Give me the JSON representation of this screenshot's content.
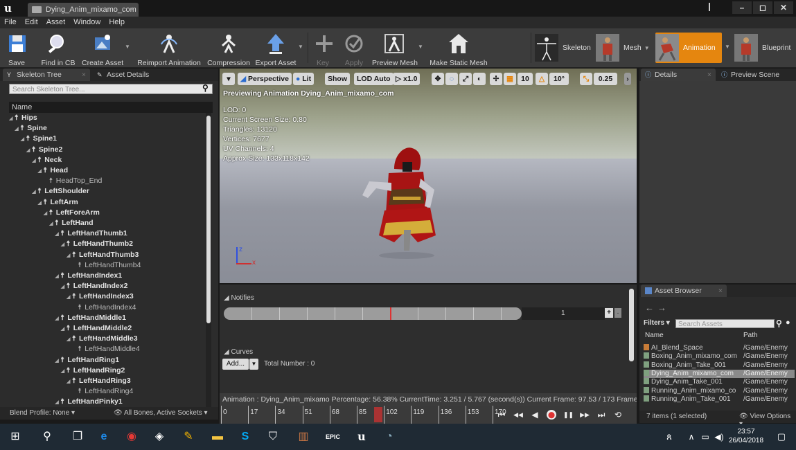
{
  "window": {
    "tab_title": "Dying_Anim_mixamo_com",
    "minimize": "–",
    "maximize": "◻",
    "close": "✕"
  },
  "menu": [
    "File",
    "Edit",
    "Asset",
    "Window",
    "Help"
  ],
  "toolbar": {
    "save": "Save",
    "find_in_cb": "Find in CB",
    "create_asset": "Create Asset",
    "reimport": "Reimport Animation",
    "compression": "Compression",
    "export_asset": "Export Asset",
    "key": "Key",
    "apply": "Apply",
    "preview_mesh": "Preview Mesh",
    "make_static_mesh": "Make Static Mesh",
    "modes": {
      "skeleton": "Skeleton",
      "mesh": "Mesh",
      "animation": "Animation",
      "blueprint": "Blueprint"
    },
    "accent": "#e5860f"
  },
  "left_panel": {
    "tab_skeleton_tree": "Skeleton Tree",
    "tab_asset_details": "Asset Details",
    "search_placeholder": "Search Skeleton Tree...",
    "column_name": "Name",
    "bones": [
      {
        "name": "Hips",
        "depth": 0,
        "bold": true
      },
      {
        "name": "Spine",
        "depth": 1,
        "bold": true
      },
      {
        "name": "Spine1",
        "depth": 2,
        "bold": true
      },
      {
        "name": "Spine2",
        "depth": 3,
        "bold": true
      },
      {
        "name": "Neck",
        "depth": 4,
        "bold": true
      },
      {
        "name": "Head",
        "depth": 5,
        "bold": true
      },
      {
        "name": "HeadTop_End",
        "depth": 6,
        "bold": false
      },
      {
        "name": "LeftShoulder",
        "depth": 4,
        "bold": true
      },
      {
        "name": "LeftArm",
        "depth": 5,
        "bold": true
      },
      {
        "name": "LeftForeArm",
        "depth": 6,
        "bold": true
      },
      {
        "name": "LeftHand",
        "depth": 7,
        "bold": true
      },
      {
        "name": "LeftHandThumb1",
        "depth": 8,
        "bold": true
      },
      {
        "name": "LeftHandThumb2",
        "depth": 9,
        "bold": true
      },
      {
        "name": "LeftHandThumb3",
        "depth": 10,
        "bold": true
      },
      {
        "name": "LeftHandThumb4",
        "depth": 11,
        "bold": false
      },
      {
        "name": "LeftHandIndex1",
        "depth": 8,
        "bold": true
      },
      {
        "name": "LeftHandIndex2",
        "depth": 9,
        "bold": true
      },
      {
        "name": "LeftHandIndex3",
        "depth": 10,
        "bold": true
      },
      {
        "name": "LeftHandIndex4",
        "depth": 11,
        "bold": false
      },
      {
        "name": "LeftHandMiddle1",
        "depth": 8,
        "bold": true
      },
      {
        "name": "LeftHandMiddle2",
        "depth": 9,
        "bold": true
      },
      {
        "name": "LeftHandMiddle3",
        "depth": 10,
        "bold": true
      },
      {
        "name": "LeftHandMiddle4",
        "depth": 11,
        "bold": false
      },
      {
        "name": "LeftHandRing1",
        "depth": 8,
        "bold": true
      },
      {
        "name": "LeftHandRing2",
        "depth": 9,
        "bold": true
      },
      {
        "name": "LeftHandRing3",
        "depth": 10,
        "bold": true
      },
      {
        "name": "LeftHandRing4",
        "depth": 11,
        "bold": false
      },
      {
        "name": "LeftHandPinky1",
        "depth": 8,
        "bold": true
      }
    ],
    "blend_profile": "Blend Profile: None",
    "bones_filter": "All Bones, Active Sockets"
  },
  "viewport": {
    "perspective": "Perspective",
    "lit": "Lit",
    "show": "Show",
    "lod": "LOD Auto",
    "speed": "x1.0",
    "grid_snap": "10",
    "rot_snap": "10°",
    "scale_snap": "0.25",
    "previewing": "Previewing Animation Dying_Anim_mixamo_com",
    "stats": [
      "LOD: 0",
      "Current Screen Size: 0.80",
      "Triangles: 13120",
      "Vertices: 7677",
      "UV Channels: 4",
      "Approx Size: 133x118x142"
    ],
    "axis_z": "z",
    "axis_x": "x"
  },
  "details": {
    "tab_details": "Details",
    "tab_preview_scene": "Preview Scene"
  },
  "timeline": {
    "notifies": "Notifies",
    "notify_track_count": "1",
    "add_track": "+",
    "remove_track": "-",
    "curves": "Curves",
    "add_curve": "Add...",
    "total_number": "Total Number : 0",
    "status": "Animation : Dying_Anim_mixamo Percentage: 56.38% CurrentTime: 3.251 / 5.767 (second(s)) Current Frame: 97.53 / 173 Frame",
    "frames": [
      "0",
      "17",
      "34",
      "51",
      "68",
      "85",
      "102",
      "119",
      "136",
      "153",
      "170"
    ],
    "playhead_fraction": 0.5638
  },
  "asset_browser": {
    "tab": "Asset Browser",
    "filters": "Filters",
    "search_placeholder": "Search Assets",
    "col_name": "Name",
    "col_path": "Path",
    "items": [
      {
        "name": "AI_Blend_Space",
        "path": "/Game/Enemy",
        "selected": false,
        "kind": "blend"
      },
      {
        "name": "Boxing_Anim_mixamo_com",
        "path": "/Game/Enemy",
        "selected": false,
        "kind": "anim"
      },
      {
        "name": "Boxing_Anim_Take_001",
        "path": "/Game/Enemy",
        "selected": false,
        "kind": "anim"
      },
      {
        "name": "Dying_Anim_mixamo_com",
        "path": "/Game/Enemy",
        "selected": true,
        "kind": "anim"
      },
      {
        "name": "Dying_Anim_Take_001",
        "path": "/Game/Enemy",
        "selected": false,
        "kind": "anim"
      },
      {
        "name": "Running_Anim_mixamo_co",
        "path": "/Game/Enemy",
        "selected": false,
        "kind": "anim"
      },
      {
        "name": "Running_Anim_Take_001",
        "path": "/Game/Enemy",
        "selected": false,
        "kind": "anim"
      }
    ],
    "count": "7 items (1 selected)",
    "view_options": "View Options"
  },
  "taskbar": {
    "time": "23:57",
    "date": "26/04/2018"
  }
}
